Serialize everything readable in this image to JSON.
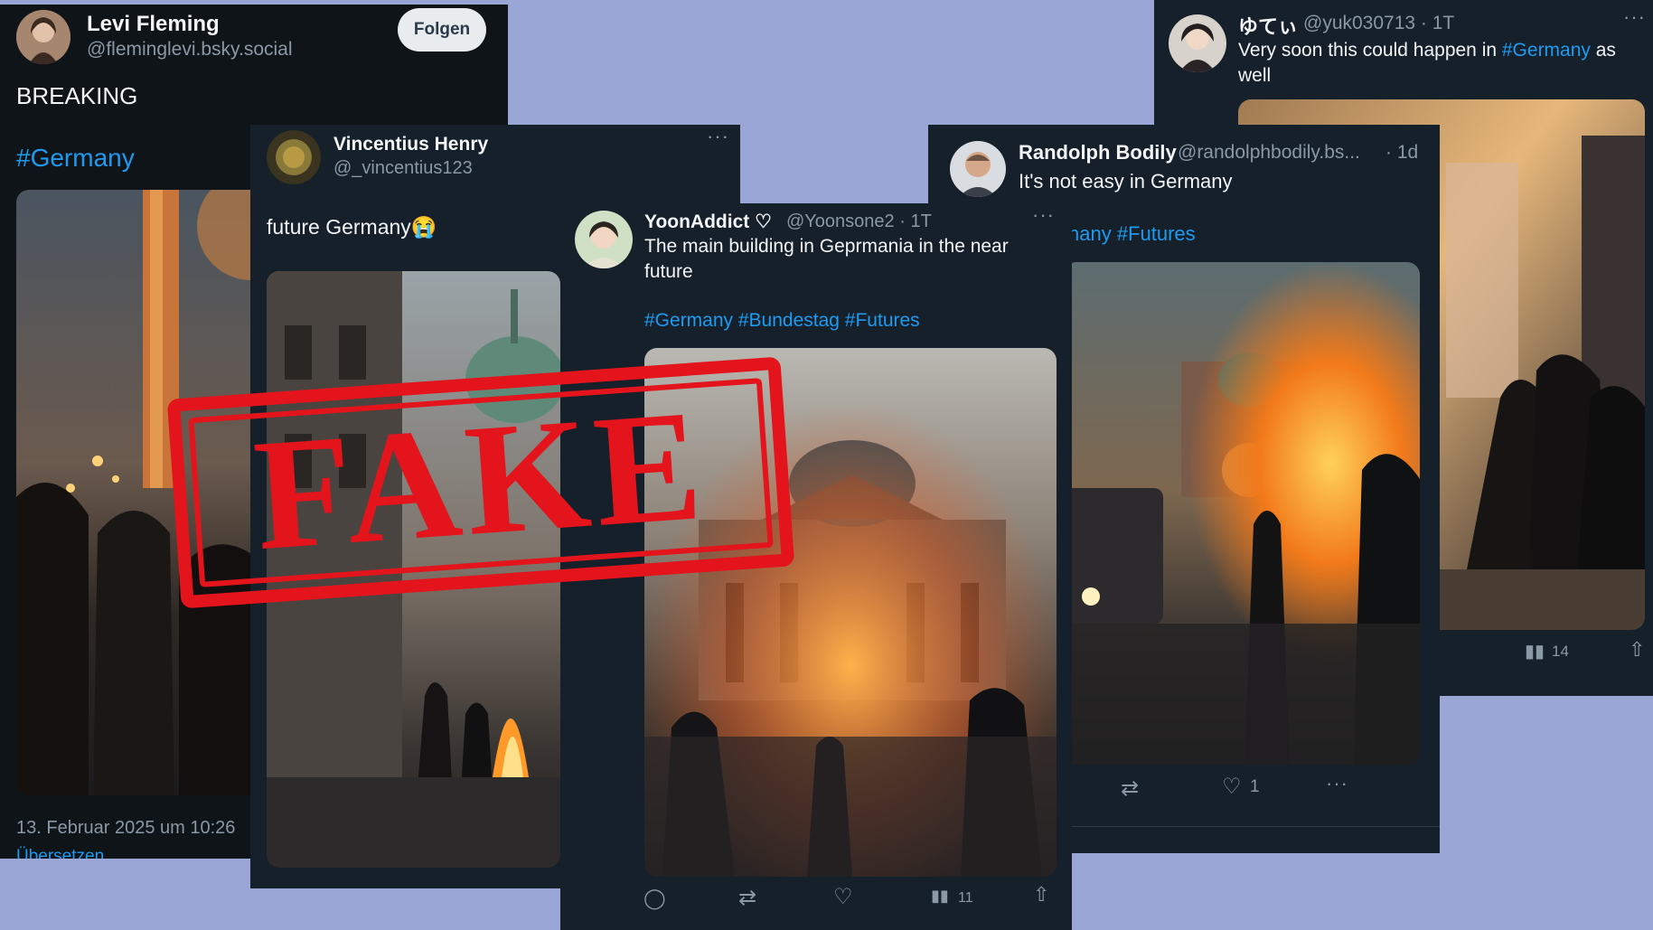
{
  "cards": {
    "levi": {
      "name": "Levi Fleming",
      "handle": "@fleminglevi.bsky.social",
      "follow_label": "Folgen",
      "text": "BREAKING",
      "hashtag": "#Germany",
      "timestamp": "13. Februar 2025 um 10:26",
      "translate": "Übersetzen"
    },
    "vincentius": {
      "name": "Vincentius Henry",
      "handle": "@_vincentius123",
      "text": "future Germany😭"
    },
    "yoon": {
      "name": "YoonAddict ♡",
      "handle": "@Yoonsone2 · 1T",
      "text_line1": "The main building in Geprmania in the near",
      "text_line2": "future",
      "hashtags": "#Germany #Bundestag #Futures",
      "views": "11"
    },
    "randolph": {
      "name": "Randolph Bodily",
      "handle": "@randolphbodily.bs...",
      "time": "· 1d",
      "text": "It's not easy in Germany",
      "hashtags": "nany #Futures",
      "likes": "1"
    },
    "yukitei": {
      "name": "ゆてぃ",
      "handle": "@yuk030713 · 1T",
      "text_pre": "Very soon this could happen in ",
      "hashtag": "#Germany",
      "text_post": " as",
      "text_line2": "well",
      "views": "14"
    }
  },
  "stamp": {
    "text": "FAKE",
    "color": "#e3141b"
  },
  "colors": {
    "background": "#9aa7d6",
    "card": "#15202b",
    "link": "#1d9bf0"
  }
}
